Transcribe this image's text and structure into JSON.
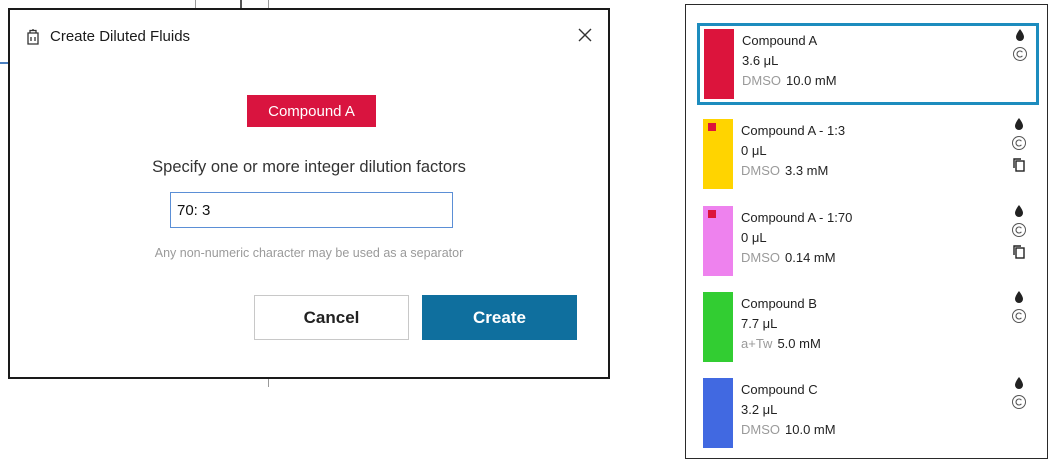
{
  "dialog": {
    "title": "Create Diluted Fluids",
    "fluid_chip": "Compound A",
    "fluid_chip_color": "#d9143f",
    "prompt": "Specify one or more integer dilution factors",
    "input_value": "70: 3",
    "hint": "Any non-numeric character may be used as a separator",
    "cancel_label": "Cancel",
    "create_label": "Create",
    "icons": {
      "title_icon": "dilution-icon",
      "close": "close-icon"
    }
  },
  "fluid_list": {
    "items": [
      {
        "name": "Compound A",
        "volume": "3.6 μL",
        "solvent": "DMSO",
        "concentration": "10.0 mM",
        "color": "#dc143c",
        "selected": true,
        "diluted": false
      },
      {
        "name": "Compound A - 1:3",
        "volume": "0 μL",
        "solvent": "DMSO",
        "concentration": "3.3 mM",
        "color": "#ffd400",
        "mark_color": "#dc143c",
        "selected": false,
        "diluted": true
      },
      {
        "name": "Compound A - 1:70",
        "volume": "0 μL",
        "solvent": "DMSO",
        "concentration": "0.14 mM",
        "color": "#ee82ee",
        "mark_color": "#dc143c",
        "selected": false,
        "diluted": true
      },
      {
        "name": "Compound B",
        "volume": "7.7 μL",
        "solvent": "a+Tw",
        "concentration": "5.0 mM",
        "color": "#32cd32",
        "selected": false,
        "diluted": false
      },
      {
        "name": "Compound C",
        "volume": "3.2 μL",
        "solvent": "DMSO",
        "concentration": "10.0 mM",
        "color": "#4169e1",
        "selected": false,
        "diluted": false
      }
    ],
    "icons": {
      "drop": "drop-icon",
      "copyright": "copyright-icon",
      "copy": "copy-icon"
    },
    "selection_color": "#1d8cbe"
  }
}
